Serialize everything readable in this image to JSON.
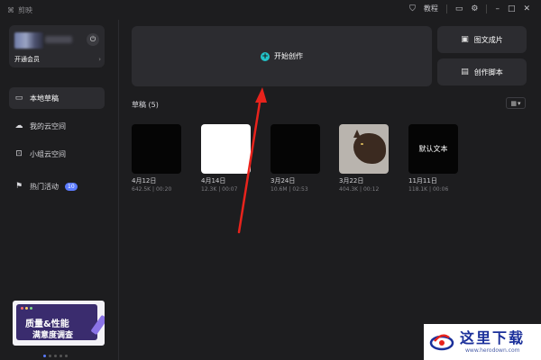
{
  "app": {
    "name": "剪映"
  },
  "titlebar": {
    "tutorial_label": "教程",
    "minimize": "–",
    "maximize": "□",
    "close": "✕"
  },
  "sidebar": {
    "vip_label": "开通会员",
    "nav": [
      {
        "label": "本地草稿",
        "icon": "monitor-icon",
        "active": true
      },
      {
        "label": "我的云空间",
        "icon": "cloud-icon",
        "active": false
      },
      {
        "label": "小组云空间",
        "icon": "group-icon",
        "active": false
      },
      {
        "label": "热门活动",
        "icon": "flag-icon",
        "active": false,
        "badge": "10"
      }
    ],
    "promo": {
      "line1": "质量&性能",
      "line2": "满意度调查"
    }
  },
  "main": {
    "create_label": "开始创作",
    "image_to_video_label": "图文成片",
    "script_label": "创作脚本",
    "drafts_title": "草稿 (5)",
    "drafts": [
      {
        "date": "4月12日",
        "size": "642.5K",
        "duration": "00:20",
        "thumb": "black",
        "overlay_text": ""
      },
      {
        "date": "4月14日",
        "size": "12.3K",
        "duration": "00:07",
        "thumb": "white",
        "overlay_text": ""
      },
      {
        "date": "3月24日",
        "size": "10.6M",
        "duration": "02:53",
        "thumb": "black",
        "overlay_text": ""
      },
      {
        "date": "3月22日",
        "size": "404.3K",
        "duration": "00:12",
        "thumb": "cat",
        "overlay_text": ""
      },
      {
        "date": "11月11日",
        "size": "118.1K",
        "duration": "00:06",
        "thumb": "black",
        "overlay_text": "默认文本"
      }
    ],
    "meta_separator": " | "
  },
  "watermark": {
    "text": "这里下载",
    "url": "www.herodown.com"
  },
  "colors": {
    "accent": "#22c3c8",
    "badge": "#5b7bff",
    "arrow": "#e8231c",
    "background": "#1d1d1f",
    "card": "#2c2c30"
  }
}
